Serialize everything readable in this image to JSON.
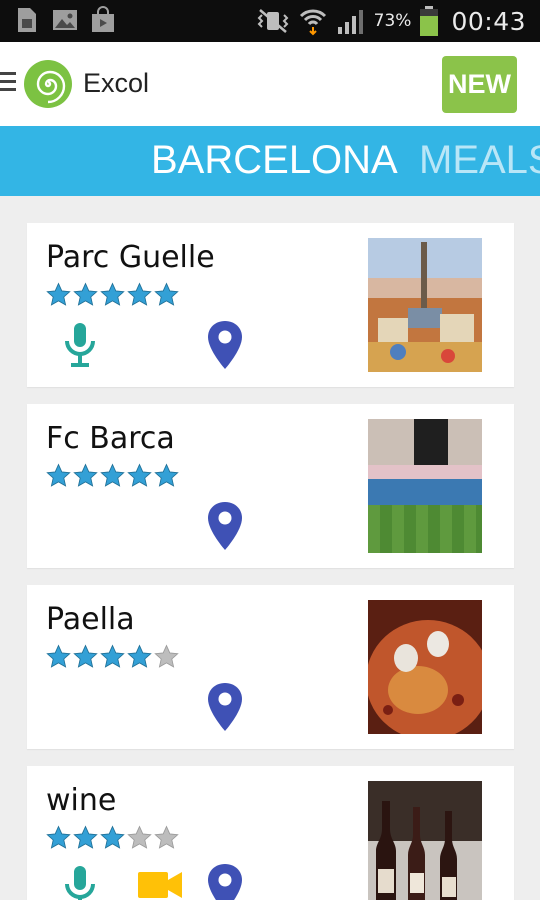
{
  "status_bar": {
    "battery": "73%",
    "time": "00:43",
    "left_icons": [
      "sim-card-icon",
      "gallery-icon",
      "shopping-bag-icon"
    ]
  },
  "app": {
    "title": "Excol",
    "new_button": "NEW",
    "accent": "#33b5e5",
    "new_color": "#8bc34a"
  },
  "tabs": [
    {
      "label": "BARCELONA",
      "active": true
    },
    {
      "label": "MEALS",
      "active": false
    }
  ],
  "items": [
    {
      "title": "Parc Guelle",
      "rating": 5,
      "has_audio": true,
      "has_video": false,
      "has_location": true,
      "thumb": "park-guell-photo"
    },
    {
      "title": "Fc Barca",
      "rating": 5,
      "has_audio": false,
      "has_video": false,
      "has_location": true,
      "thumb": "stadium-photo"
    },
    {
      "title": "Paella",
      "rating": 4,
      "has_audio": false,
      "has_video": false,
      "has_location": true,
      "thumb": "paella-photo"
    },
    {
      "title": "wine",
      "rating": 3,
      "has_audio": true,
      "has_video": true,
      "has_location": true,
      "thumb": "wine-bottles-photo"
    }
  ],
  "colors": {
    "star_on": "#33a0d6",
    "star_off": "#bdbdbd",
    "mic": "#26a69a",
    "video": "#ffc107",
    "pin": "#3f51b5"
  }
}
